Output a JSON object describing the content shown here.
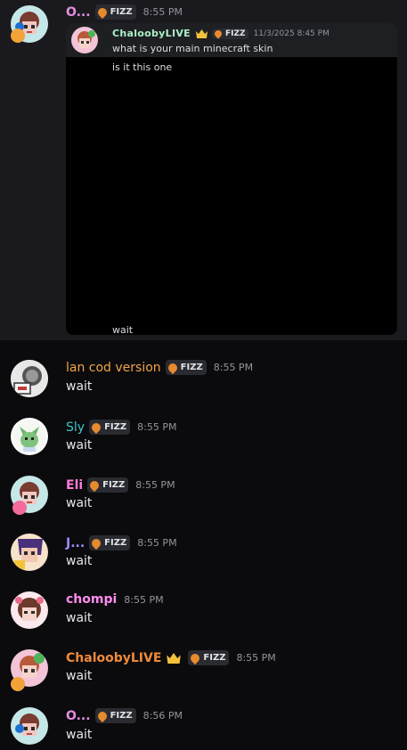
{
  "messages": [
    {
      "author": "O...",
      "author_color": "#e58de0",
      "tag": "FIZZ",
      "time": "8:55 PM",
      "embed": {
        "author": "ChaloobyLIVE",
        "tag": "FIZZ",
        "time": "11/3/2025 8:45 PM",
        "lines": [
          "what is your main minecraft skin",
          "is it this one"
        ],
        "footer": "wait"
      }
    },
    {
      "author": "lan cod version",
      "author_color": "#f0a44a",
      "tag": "FIZZ",
      "time": "8:55 PM",
      "text": "wait"
    },
    {
      "author": "Sly",
      "author_color": "#3fc6c7",
      "tag": "FIZZ",
      "time": "8:55 PM",
      "text": "wait"
    },
    {
      "author": "Eli",
      "author_color": "#ff7bd6",
      "tag": "FIZZ",
      "time": "8:55 PM",
      "text": "wait"
    },
    {
      "author": "J...",
      "author_color": "#9b8cff",
      "tag": "FIZZ",
      "time": "8:55 PM",
      "text": "wait"
    },
    {
      "author": "chompi",
      "author_color": "#ff8cf0",
      "time": "8:55 PM",
      "text": "wait"
    },
    {
      "author": "ChaloobyLIVE",
      "author_color": "#f08a3a",
      "tag": "FIZZ",
      "time": "8:55 PM",
      "text": "wait"
    },
    {
      "author": "O...",
      "author_color": "#e58de0",
      "tag": "FIZZ",
      "time": "8:56 PM",
      "text": "wait"
    }
  ],
  "colors": {
    "background": "#0b0b0d",
    "highlight": "#1a1a1e",
    "tag_icon": "#e68a2e",
    "crown": "#f2c23a"
  }
}
